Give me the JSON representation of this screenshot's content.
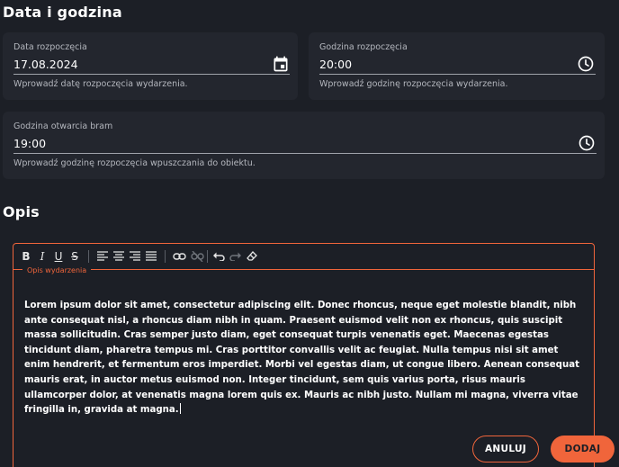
{
  "sections": {
    "datetime_title": "Data i godzina",
    "description_title": "Opis"
  },
  "fields": {
    "start_date": {
      "label": "Data rozpoczęcia",
      "value": "17.08.2024",
      "hint": "Wprowadź datę rozpoczęcia wydarzenia.",
      "icon": "calendar-icon"
    },
    "start_time": {
      "label": "Godzina rozpoczęcia",
      "value": "20:00",
      "hint": "Wprowadź godzinę rozpoczęcia wydarzenia.",
      "icon": "clock-icon"
    },
    "gates_open": {
      "label": "Godzina otwarcia bram",
      "value": "19:00",
      "hint": "Wprowadź godzinę rozpoczęcia wpuszczania do obiektu.",
      "icon": "clock-icon"
    }
  },
  "editor": {
    "legend": "Opis wydarzenia",
    "content": "Lorem ipsum dolor sit amet, consectetur adipiscing elit. Donec rhoncus, neque eget molestie blandit, nibh ante consequat nisl, a rhoncus diam nibh in quam. Praesent euismod velit non ex rhoncus, quis suscipit massa sollicitudin. Cras semper justo diam, eget consequat turpis venenatis eget. Maecenas egestas tincidunt diam, pharetra tempus mi. Cras porttitor convallis velit ac feugiat. Nulla tempus nisi sit amet enim hendrerit, et fermentum eros imperdiet. Morbi vel egestas diam, ut congue libero. Aenean consequat mauris erat, in auctor metus euismod non. Integer tincidunt, sem quis varius porta, risus mauris ullamcorper dolor, at venenatis magna lorem quis ex. Mauris ac nibh justo. Nullam mi magna, viverra vitae fringilla in, gravida at magna.",
    "toolbar": [
      "bold-icon",
      "italic-icon",
      "underline-icon",
      "strikethrough-icon",
      "align-left-icon",
      "align-center-icon",
      "align-right-icon",
      "align-justify-icon",
      "link-icon",
      "unlink-icon",
      "undo-icon",
      "redo-icon",
      "eraser-icon"
    ]
  },
  "actions": {
    "cancel_label": "ANULUJ",
    "add_label": "DODAJ"
  },
  "colors": {
    "accent": "#f0653b",
    "background": "#1c1f26",
    "field_bg": "#23262e"
  }
}
